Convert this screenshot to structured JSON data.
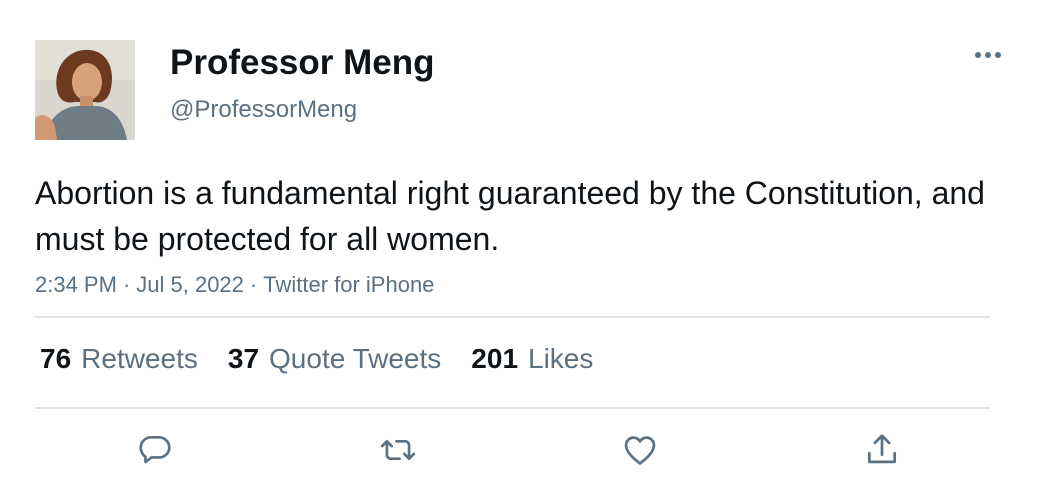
{
  "author": {
    "display_name": "Professor Meng",
    "handle": "@ProfessorMeng"
  },
  "tweet": {
    "text": "Abortion is a fundamental right guaranteed by the Constitution, and must be protected for all women.",
    "time": "2:34 PM",
    "date": "Jul 5, 2022",
    "source": "Twitter for iPhone"
  },
  "stats": {
    "retweets_count": "76",
    "retweets_label": "Retweets",
    "quotes_count": "37",
    "quotes_label": "Quote Tweets",
    "likes_count": "201",
    "likes_label": "Likes"
  },
  "icons": {
    "more": "more-dots-icon",
    "reply": "reply-icon",
    "retweet": "retweet-icon",
    "like": "like-icon",
    "share": "share-icon"
  },
  "colors": {
    "text": "#0f1419",
    "secondary": "#5b7083",
    "divider": "#e1e4e8",
    "icon": "#5b7083"
  }
}
